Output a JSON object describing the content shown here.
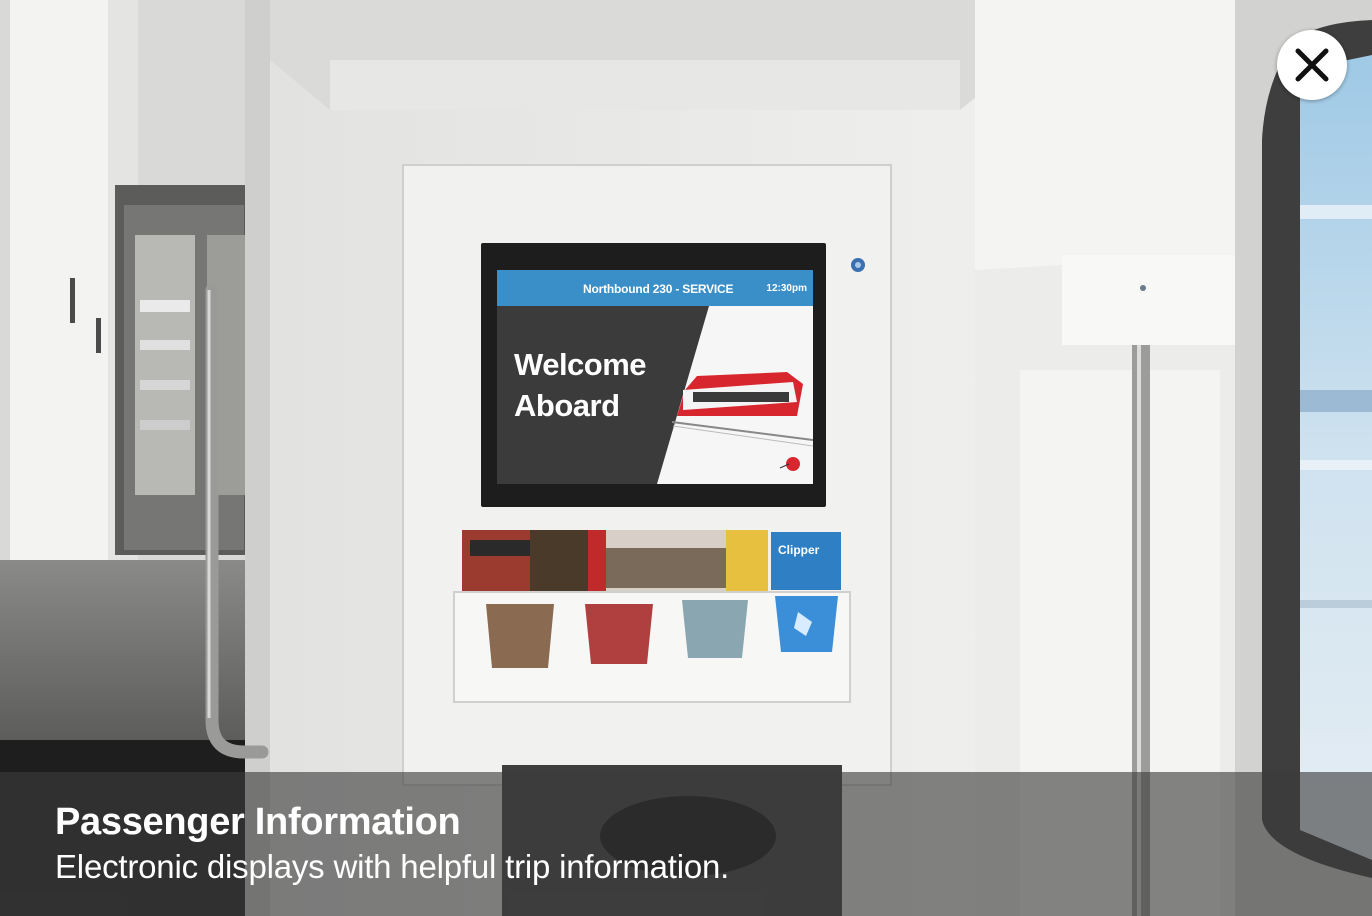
{
  "display": {
    "route": "Northbound 230 - SERVICE",
    "time": "12:30pm",
    "welcome_line1": "Welcome",
    "welcome_line2": "Aboard"
  },
  "brochures": {
    "clipper_label": "Clipper"
  },
  "caption": {
    "title": "Passenger Information",
    "description": "Electronic displays with helpful trip information."
  },
  "controls": {
    "close_icon": "close-icon"
  },
  "colors": {
    "display_header": "#3a8fc9",
    "caption_overlay": "#3c3c3c",
    "brand_red": "#d8262e"
  }
}
